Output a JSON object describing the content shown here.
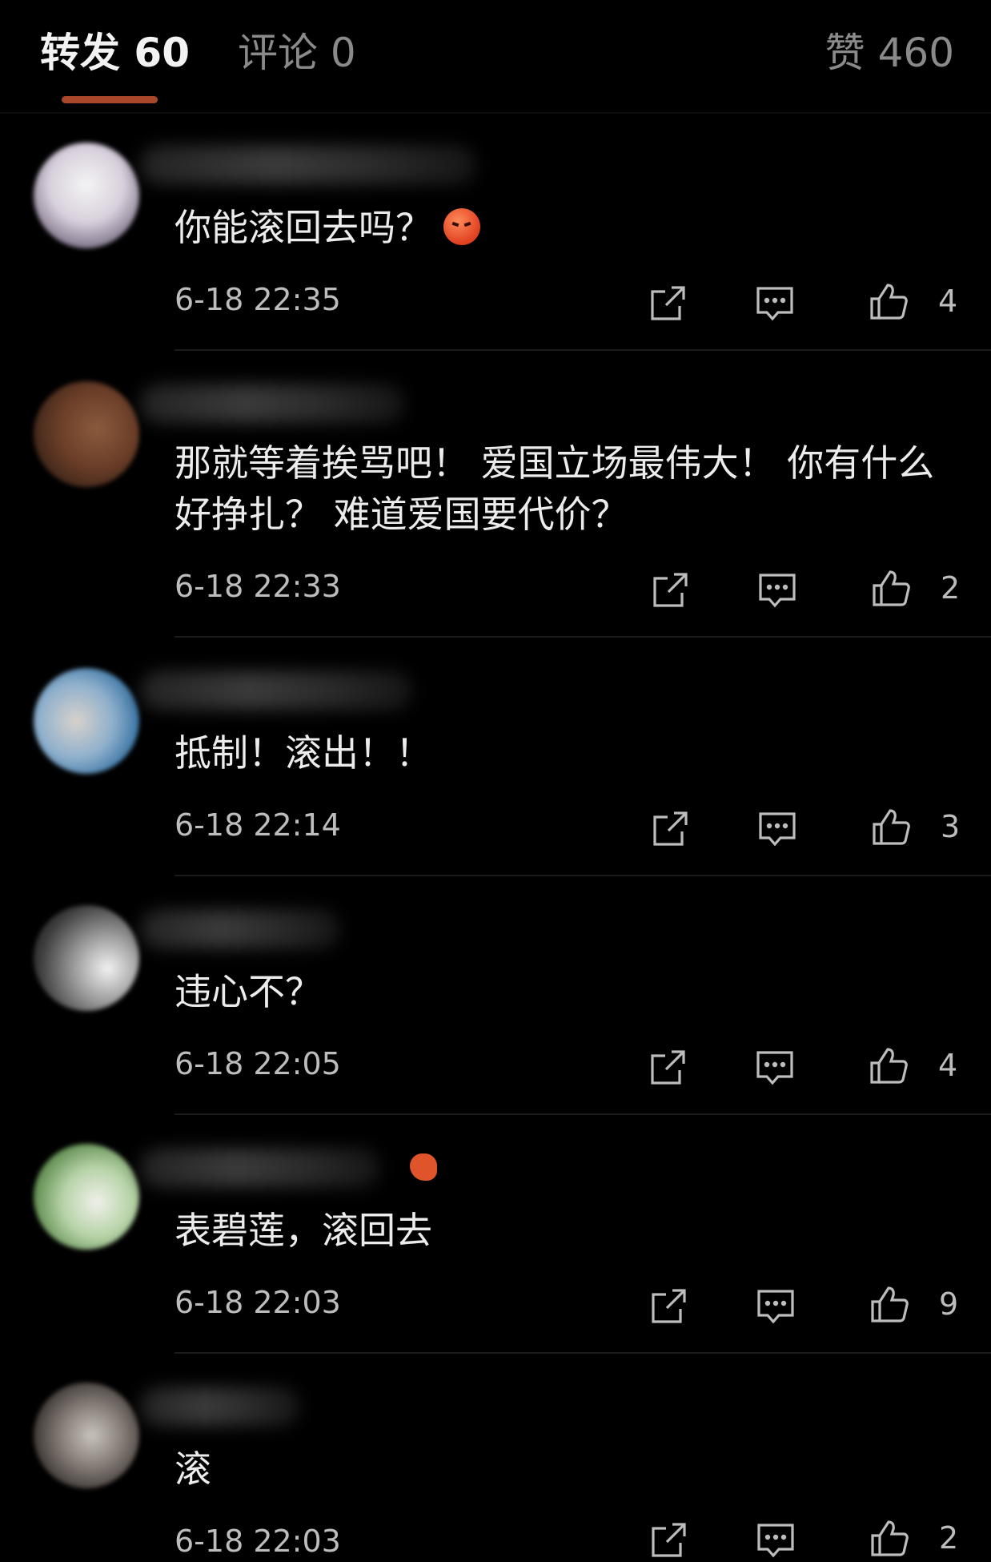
{
  "tabs": {
    "repost": "转发 60",
    "comment": "评论 0",
    "like": "赞 460"
  },
  "comments": [
    {
      "text": "你能滚回去吗？",
      "time": "6-18 22:35",
      "likes": "4"
    },
    {
      "text": "那就等着挨骂吧！ 爱国立场最伟大！ 你有什么好挣扎？ 难道爱国要代价？",
      "time": "6-18 22:33",
      "likes": "2"
    },
    {
      "text": "抵制！滚出！！",
      "time": "6-18 22:14",
      "likes": "3"
    },
    {
      "text": "违心不？",
      "time": "6-18 22:05",
      "likes": "4"
    },
    {
      "text": "表碧莲，滚回去",
      "time": "6-18 22:03",
      "likes": "9"
    },
    {
      "text": "滚",
      "time": "6-18 22:03",
      "likes": "2"
    }
  ],
  "colors": {
    "background": "#000000",
    "accent_underline": "#a8472a",
    "primary_text": "#ececec",
    "secondary_text": "#bdbdbd",
    "inactive_tab": "#8a8a8a"
  },
  "icons": [
    "share-icon",
    "reply-icon",
    "like-icon",
    "angry-face-emoji",
    "koi-badge-icon"
  ]
}
